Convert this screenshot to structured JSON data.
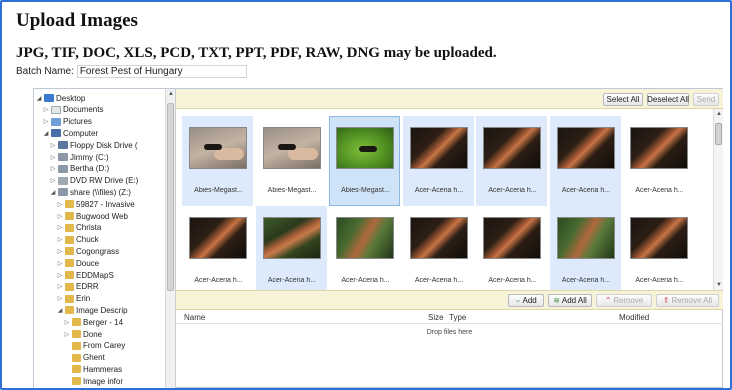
{
  "page": {
    "title": "Upload Images",
    "allowed_types": "JPG, TIF, DOC, XLS, PCD, TXT, PPT, PDF, RAW, DNG may be uploaded.",
    "batch_label": "Batch Name:",
    "batch_value": "Forest Pest of Hungary"
  },
  "tree": {
    "items": [
      {
        "label": "Desktop",
        "indent": 0,
        "icon": "desktop-icon",
        "toggle": "expanded"
      },
      {
        "label": "Documents",
        "indent": 1,
        "icon": "documents-icon",
        "toggle": "collapsed"
      },
      {
        "label": "Pictures",
        "indent": 1,
        "icon": "pictures-icon",
        "toggle": "collapsed"
      },
      {
        "label": "Computer",
        "indent": 1,
        "icon": "computer-icon",
        "toggle": "expanded"
      },
      {
        "label": "Floppy Disk Drive (",
        "indent": 2,
        "icon": "floppy-icon",
        "toggle": "collapsed"
      },
      {
        "label": "Jimmy (C:)",
        "indent": 2,
        "icon": "drive-icon",
        "toggle": "collapsed"
      },
      {
        "label": "Bertha (D:)",
        "indent": 2,
        "icon": "drive-icon",
        "toggle": "collapsed"
      },
      {
        "label": "DVD RW Drive (E:)",
        "indent": 2,
        "icon": "dvd-icon",
        "toggle": "collapsed"
      },
      {
        "label": "share (\\\\files) (Z:)",
        "indent": 2,
        "icon": "network-drive-icon",
        "toggle": "expanded"
      },
      {
        "label": "59827 - Invasive",
        "indent": 3,
        "icon": "folder-icon",
        "toggle": "collapsed"
      },
      {
        "label": "Bugwood Web",
        "indent": 3,
        "icon": "folder-icon",
        "toggle": "collapsed"
      },
      {
        "label": "Christa",
        "indent": 3,
        "icon": "folder-icon",
        "toggle": "collapsed"
      },
      {
        "label": "Chuck",
        "indent": 3,
        "icon": "folder-icon",
        "toggle": "collapsed"
      },
      {
        "label": "Cogongrass",
        "indent": 3,
        "icon": "folder-icon",
        "toggle": "collapsed"
      },
      {
        "label": "Douce",
        "indent": 3,
        "icon": "folder-icon",
        "toggle": "collapsed"
      },
      {
        "label": "EDDMapS",
        "indent": 3,
        "icon": "folder-icon",
        "toggle": "collapsed"
      },
      {
        "label": "EDRR",
        "indent": 3,
        "icon": "folder-icon",
        "toggle": "collapsed"
      },
      {
        "label": "Erin",
        "indent": 3,
        "icon": "folder-icon",
        "toggle": "collapsed"
      },
      {
        "label": "Image Descrip",
        "indent": 3,
        "icon": "folder-icon",
        "toggle": "expanded"
      },
      {
        "label": "Berger - 14",
        "indent": 4,
        "icon": "folder-icon",
        "toggle": "collapsed"
      },
      {
        "label": "Done",
        "indent": 4,
        "icon": "folder-icon",
        "toggle": "collapsed"
      },
      {
        "label": "From Carey",
        "indent": 4,
        "icon": "folder-icon",
        "toggle": "none"
      },
      {
        "label": "Ghent",
        "indent": 4,
        "icon": "folder-icon",
        "toggle": "none"
      },
      {
        "label": "Hammeras",
        "indent": 4,
        "icon": "folder-icon",
        "toggle": "none"
      },
      {
        "label": "Image infor",
        "indent": 4,
        "icon": "folder-icon",
        "toggle": "none"
      }
    ]
  },
  "toolbar": {
    "select_all": "Select All",
    "deselect_all": "Deselect All",
    "send": "Send",
    "add": "Add",
    "add_all": "Add All",
    "remove": "Remove",
    "remove_all": "Remove All"
  },
  "thumbnails": [
    {
      "caption": "Abies-Megast...",
      "photo": "wasp",
      "state": "highlight"
    },
    {
      "caption": "Abies-Megast...",
      "photo": "wasp",
      "state": "plain"
    },
    {
      "caption": "Abies-Megast...",
      "photo": "green",
      "state": "selected"
    },
    {
      "caption": "Acer-Aceria h...",
      "photo": "branch",
      "state": "highlight"
    },
    {
      "caption": "Acer-Aceria h...",
      "photo": "branch",
      "state": "highlight"
    },
    {
      "caption": "Acer-Aceria h...",
      "photo": "branch",
      "state": "highlight"
    },
    {
      "caption": "Acer-Aceria h...",
      "photo": "branch",
      "state": "plain"
    },
    {
      "caption": "Acer-Aceria h...",
      "photo": "branch",
      "state": "plain"
    },
    {
      "caption": "Acer-Aceria h...",
      "photo": "branch2",
      "state": "highlight"
    },
    {
      "caption": "Acer-Aceria h...",
      "photo": "branch3",
      "state": "plain"
    },
    {
      "caption": "Acer-Aceria h...",
      "photo": "branch",
      "state": "plain"
    },
    {
      "caption": "Acer-Aceria h...",
      "photo": "branch",
      "state": "plain"
    },
    {
      "caption": "Acer-Aceria h...",
      "photo": "branch3",
      "state": "highlight"
    },
    {
      "caption": "Acer-Aceria h...",
      "photo": "branch",
      "state": "plain"
    }
  ],
  "file_list": {
    "col_name": "Name",
    "col_size": "Size",
    "col_type": "Type",
    "col_modified": "Modified",
    "empty_text": "Drop files here"
  },
  "colors": {
    "frame_border": "#2f6fd8",
    "toolbar_bg": "#f7f3d8",
    "tile_highlight": "#dceafb",
    "tile_selected": "#cfe3f8"
  }
}
